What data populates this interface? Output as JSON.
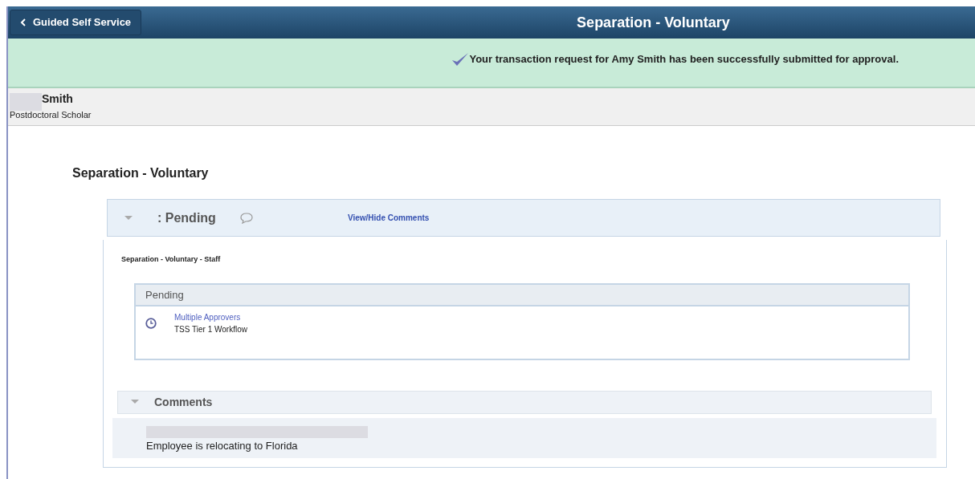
{
  "header": {
    "back_button": "Guided Self Service",
    "title": "Separation - Voluntary"
  },
  "banner": {
    "message": "Your transaction request for Amy Smith has been successfully submitted for approval."
  },
  "person": {
    "name": "Smith",
    "title": "Postdoctoral Scholar"
  },
  "section_title": "Separation - Voluntary",
  "approval": {
    "expanded": true,
    "status": ": Pending",
    "link": "View/Hide Comments",
    "process": "Separation - Voluntary - Staff",
    "step": {
      "header": "Pending",
      "approver": "Multiple Approvers",
      "workflow": "TSS Tier 1 Workflow"
    }
  },
  "comments": {
    "expanded": true,
    "header": "Comments",
    "items": [
      {
        "text": "Employee is relocating to Florida"
      }
    ]
  }
}
